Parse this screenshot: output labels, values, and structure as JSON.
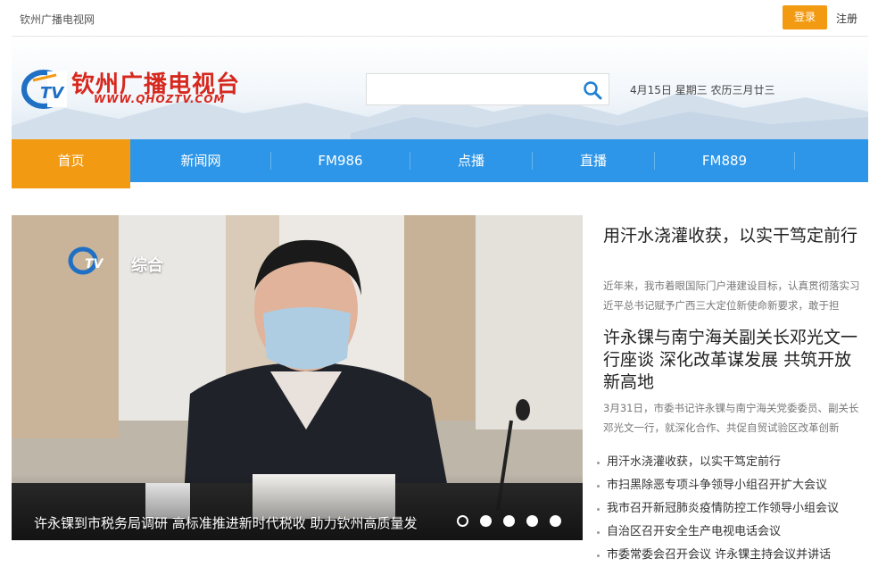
{
  "topbar": {
    "site_name": "钦州广播电视网",
    "login": "登录",
    "register": "注册"
  },
  "header": {
    "logo_cn": "钦州广播电视台",
    "logo_url": "WWW.QHOZTV.COM",
    "search_placeholder": "",
    "date": "4月15日 星期三 农历三月廿三"
  },
  "nav": {
    "items": [
      "首页",
      "新闻网",
      "FM986",
      "点播",
      "直播",
      "FM889"
    ],
    "active_index": 0
  },
  "slide": {
    "channel_logo": "综合",
    "caption": "许永锞到市税务局调研 高标准推进新时代税收 助力钦州高质量发",
    "dot_count": 5,
    "active_dot": 0
  },
  "features": [
    {
      "title": "用汗水浇灌收获，以实干笃定前行",
      "summary": "近年来，我市着眼国际门户港建设目标，认真贯彻落实习近平总书记赋予广西三大定位新使命新要求，敢于担"
    },
    {
      "title": "许永锞与南宁海关副关长邓光文一行座谈 深化改革谋发展 共筑开放新高地",
      "summary": "3月31日，市委书记许永锞与南宁海关党委委员、副关长邓光文一行，就深化合作、共促自贸试验区改革创新"
    }
  ],
  "news_list": [
    "用汗水浇灌收获，以实干笃定前行",
    "市扫黑除恶专项斗争领导小组召开扩大会议",
    "我市召开新冠肺炎疫情防控工作领导小组会议",
    "自治区召开安全生产电视电话会议",
    "市委常委会召开会议 许永锞主持会议并讲话"
  ],
  "colors": {
    "nav_blue": "#2d96e8",
    "accent_orange": "#f39a13",
    "logo_red": "#d7281e"
  }
}
